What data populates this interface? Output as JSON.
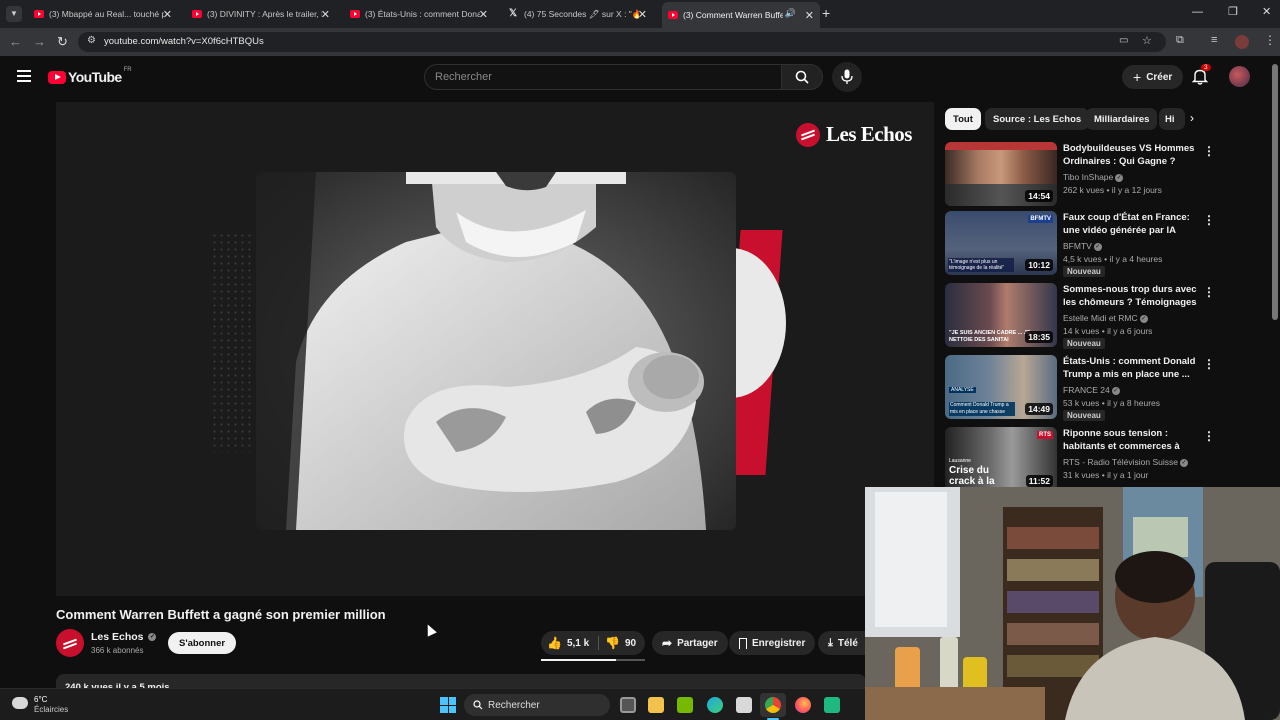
{
  "browser": {
    "tabs": [
      {
        "title": "(3) Mbappé au Real... touché p",
        "favicon": "youtube-icon"
      },
      {
        "title": "(3) DIVINITY : Après le trailer, La",
        "favicon": "youtube-icon"
      },
      {
        "title": "(3) États-Unis : comment Donal",
        "favicon": "youtube-icon"
      },
      {
        "title": "(4) 75 Secondes 🖋 sur X : \"🔥 E",
        "favicon": "x-icon"
      },
      {
        "title": "(3) Comment Warren Buffett",
        "favicon": "youtube-icon",
        "active": true
      }
    ],
    "url": "youtube.com/watch?v=X0f6cHTBQUs"
  },
  "youtube": {
    "logo": "YouTube",
    "country": "FR",
    "search_placeholder": "Rechercher",
    "create_label": "Créer",
    "notifications_count": "3"
  },
  "player": {
    "brand": "Les Echos"
  },
  "video": {
    "title": "Comment Warren Buffett a gagné son premier million",
    "channel": "Les Echos",
    "subscribers": "366 k abonnés",
    "subscribe_label": "S'abonner",
    "likes": "5,1 k",
    "dislikes": "90",
    "share_label": "Partager",
    "save_label": "Enregistrer",
    "download_label": "Télé",
    "description_meta": "240 k vues  il y a 5 mois"
  },
  "chips": [
    "Tout",
    "Source : Les Echos",
    "Milliardaires",
    "Hi"
  ],
  "recommendations": [
    {
      "title": "Bodybuildeuses VS Hommes Ordinaires : Qui Gagne ?",
      "channel": "Tibo InShape",
      "meta": "262 k vues • il y a 12 jours",
      "duration": "14:54",
      "badge": ""
    },
    {
      "title": "Faux coup d'État en France: une vidéo générée par IA devient ...",
      "channel": "BFMTV",
      "meta": "4,5 k vues • il y a 4 heures",
      "duration": "10:12",
      "badge": "Nouveau"
    },
    {
      "title": "Sommes-nous trop durs avec les chômeurs ? Témoignages ...",
      "channel": "Estelle Midi et RMC",
      "meta": "14 k vues • il y a 6 jours",
      "duration": "18:35",
      "badge": "Nouveau"
    },
    {
      "title": "États-Unis : comment Donald Trump a mis en place une ...",
      "channel": "FRANCE 24",
      "meta": "53 k vues • il y a 8 heures",
      "duration": "14:49",
      "badge": "Nouveau"
    },
    {
      "title": "Riponne sous tension : habitants et commerces à bou...",
      "channel": "RTS - Radio Télévision Suisse",
      "meta": "31 k vues • il y a 1 jour",
      "duration": "11:52",
      "badge": ""
    }
  ],
  "thumb_texts": {
    "bfm": "BFMTV",
    "bfm_caption": "\"L'image n'est plus un témoignage de la réalité\"",
    "rmc_caption": "\"JE SUIS ANCIEN CADRE ... JE NETTOIE DES SANITAI",
    "f24_tag": "ANALYSE",
    "f24_caption": "Comment Donald Trump a mis en place une chasse aux im",
    "rts_tag": "RTS",
    "rts_place": "Lausanne",
    "rts_caption": "Crise du crack à la Riponne"
  },
  "taskbar": {
    "weather_temp": "6°C",
    "weather_desc": "Éclaircies",
    "search_label": "Rechercher"
  }
}
